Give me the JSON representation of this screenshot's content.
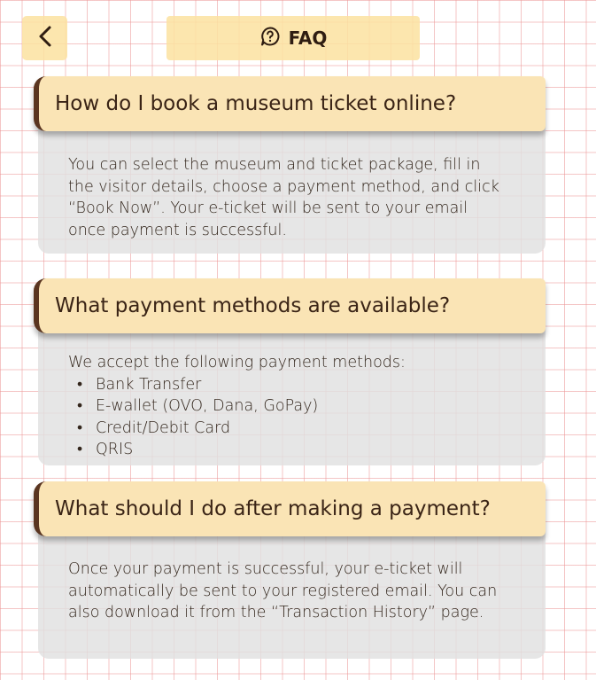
{
  "header": {
    "back_icon": "chevron-left-icon",
    "title_icon": "help-circle-icon",
    "title": "FAQ"
  },
  "faqs": [
    {
      "question": "How do I book a museum ticket online?",
      "answer_lines": [
        "You can select the museum and ticket package, fill in",
        "the visitor details, choose a payment method, and click",
        "“Book Now”. Your e-ticket will be sent to your email",
        "once payment is successful."
      ]
    },
    {
      "question": "What payment methods are available?",
      "answer_intro": "We accept the following payment methods:",
      "answer_items": [
        "Bank Transfer",
        "E-wallet (OVO, Dana, GoPay)",
        "Credit/Debit Card",
        "QRIS"
      ]
    },
    {
      "question": "What should I do after making a payment?",
      "answer_lines": [
        "Once your payment is successful, your e-ticket will",
        "automatically be sent to your registered email. You can",
        "also download it from the “Transaction History” page."
      ]
    }
  ],
  "colors": {
    "accent_panel": "#fae4b5",
    "accent_border": "#5a3520",
    "card_bg": "#e0e0e0",
    "grid_line": "#ec9696"
  }
}
